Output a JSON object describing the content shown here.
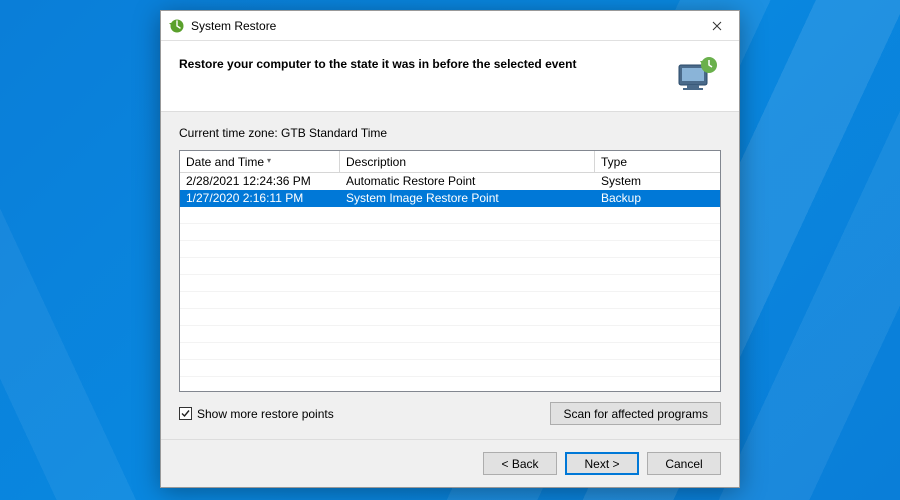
{
  "window": {
    "title": "System Restore"
  },
  "header": {
    "heading": "Restore your computer to the state it was in before the selected event"
  },
  "body": {
    "timezone_label": "Current time zone: GTB Standard Time",
    "columns": {
      "date": "Date and Time",
      "description": "Description",
      "type": "Type"
    },
    "rows": [
      {
        "date": "2/28/2021 12:24:36 PM",
        "description": "Automatic Restore Point",
        "type": "System",
        "selected": false
      },
      {
        "date": "1/27/2020 2:16:11 PM",
        "description": "System Image Restore Point",
        "type": "Backup",
        "selected": true
      }
    ],
    "checkbox": {
      "checked": true,
      "label": "Show more restore points"
    },
    "scan_button": "Scan for affected programs"
  },
  "footer": {
    "back": "< Back",
    "next": "Next >",
    "cancel": "Cancel"
  }
}
